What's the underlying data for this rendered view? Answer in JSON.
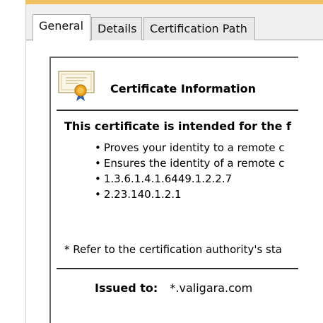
{
  "tabs": [
    {
      "label": "General",
      "active": true
    },
    {
      "label": "Details",
      "active": false
    },
    {
      "label": "Certification Path",
      "active": false
    }
  ],
  "certificate": {
    "icon": "certificate-icon",
    "title": "Certificate Information",
    "purpose_heading": "This certificate is intended for the f",
    "purposes": [
      "Proves your identity to a remote c",
      "Ensures the identity of a remote c",
      "1.3.6.1.4.1.6449.1.2.2.7",
      "2.23.140.1.2.1"
    ],
    "refer_note": "* Refer to the certification authority's sta",
    "issued_to_label": "Issued to:",
    "issued_to_value": "*.valigara.com"
  },
  "colors": {
    "title_bar_accent": "#f0c060",
    "tab_background": "#f0f0f0",
    "border": "#646464"
  }
}
